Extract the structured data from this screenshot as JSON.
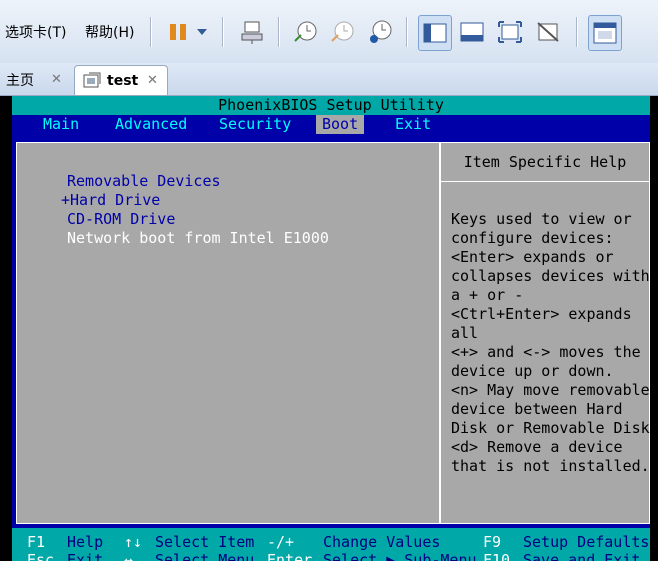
{
  "menubar": {
    "tabs_label": "选项卡(T)",
    "help_label": "帮助(H)"
  },
  "tabs": [
    {
      "label": "主页",
      "active": false
    },
    {
      "label": "test",
      "active": true
    }
  ],
  "bios": {
    "title": "PhoenixBIOS Setup Utility",
    "menus": [
      "Main",
      "Advanced",
      "Security",
      "Boot",
      "Exit"
    ],
    "selected_menu": "Boot",
    "boot_order": [
      "Removable Devices",
      "+Hard Drive",
      "CD-ROM Drive",
      "Network boot from Intel E1000"
    ],
    "highlighted_item": "Network boot from Intel E1000",
    "help_title": "Item Specific Help",
    "help_lines": [
      "Keys used to view or",
      "configure devices:",
      "<Enter> expands or",
      "collapses devices with",
      "a + or -",
      "<Ctrl+Enter> expands",
      "all",
      "<+> and <-> moves the",
      "device up or down.",
      "<n> May move removable",
      "device between Hard",
      "Disk or Removable Disk",
      "<d> Remove a device",
      "that is not installed."
    ],
    "footer_row1": {
      "k1": "F1",
      "d1": "Help",
      "k2": "↑↓",
      "d2": "Select Item",
      "k3": "-/+",
      "d3": "Change Values",
      "k4": "F9",
      "d4": "Setup Defaults"
    },
    "footer_row2": {
      "k1": "Esc",
      "d1": "Exit",
      "k2": "↔",
      "d2": "Select Menu",
      "k3": "Enter",
      "d3": "Select ▶ Sub-Menu",
      "k4": "F10",
      "d4": "Save and Exit"
    }
  }
}
